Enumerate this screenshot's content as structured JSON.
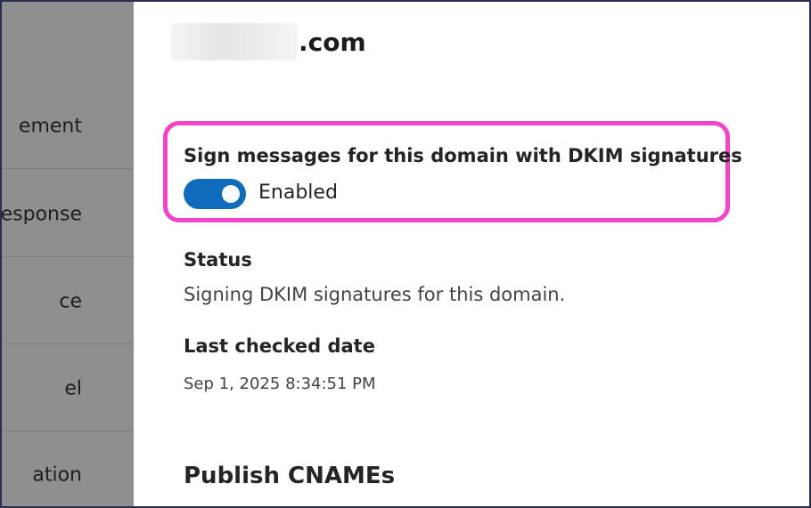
{
  "side_nav": {
    "items": [
      {
        "label": "ement"
      },
      {
        "label": "esponse"
      },
      {
        "label": "ce"
      },
      {
        "label": "el"
      },
      {
        "label": "ation"
      }
    ]
  },
  "panel": {
    "domain_suffix": ".com",
    "dkim": {
      "label": "Sign messages for this domain with DKIM signatures",
      "toggle_state": "Enabled",
      "toggle_on": true
    },
    "status": {
      "label": "Status",
      "value": "Signing DKIM signatures for this domain."
    },
    "last_checked": {
      "label": "Last checked date",
      "value": "Sep 1, 2025 8:34:51 PM"
    },
    "publish_heading": "Publish CNAMEs"
  },
  "colors": {
    "toggle_on": "#0f6cbd",
    "highlight": "#f045c8",
    "overlay": "#8f8f8f"
  }
}
